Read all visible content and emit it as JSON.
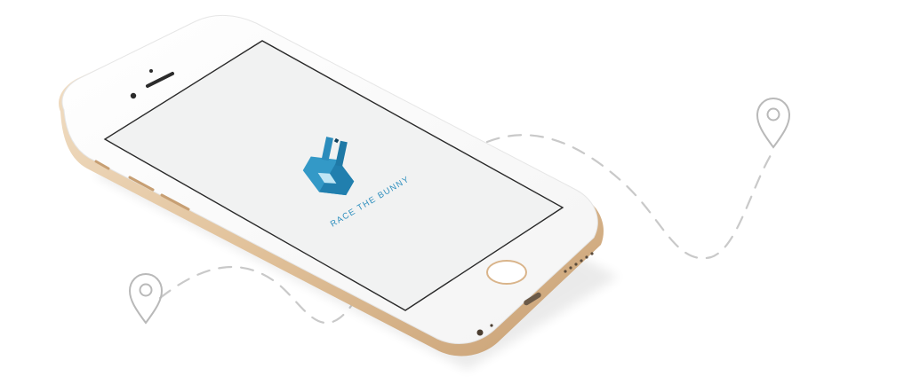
{
  "app": {
    "title": "RACE THE BUNNY",
    "logo_icon": "bunny-icon",
    "brand_color": "#2f8fbe"
  },
  "route": {
    "start_icon": "map-pin-icon",
    "end_icon": "map-pin-icon",
    "line_color": "#c9c9c9"
  },
  "device": {
    "type": "smartphone",
    "finish": "gold",
    "screen_color": "#f1f2f2"
  }
}
